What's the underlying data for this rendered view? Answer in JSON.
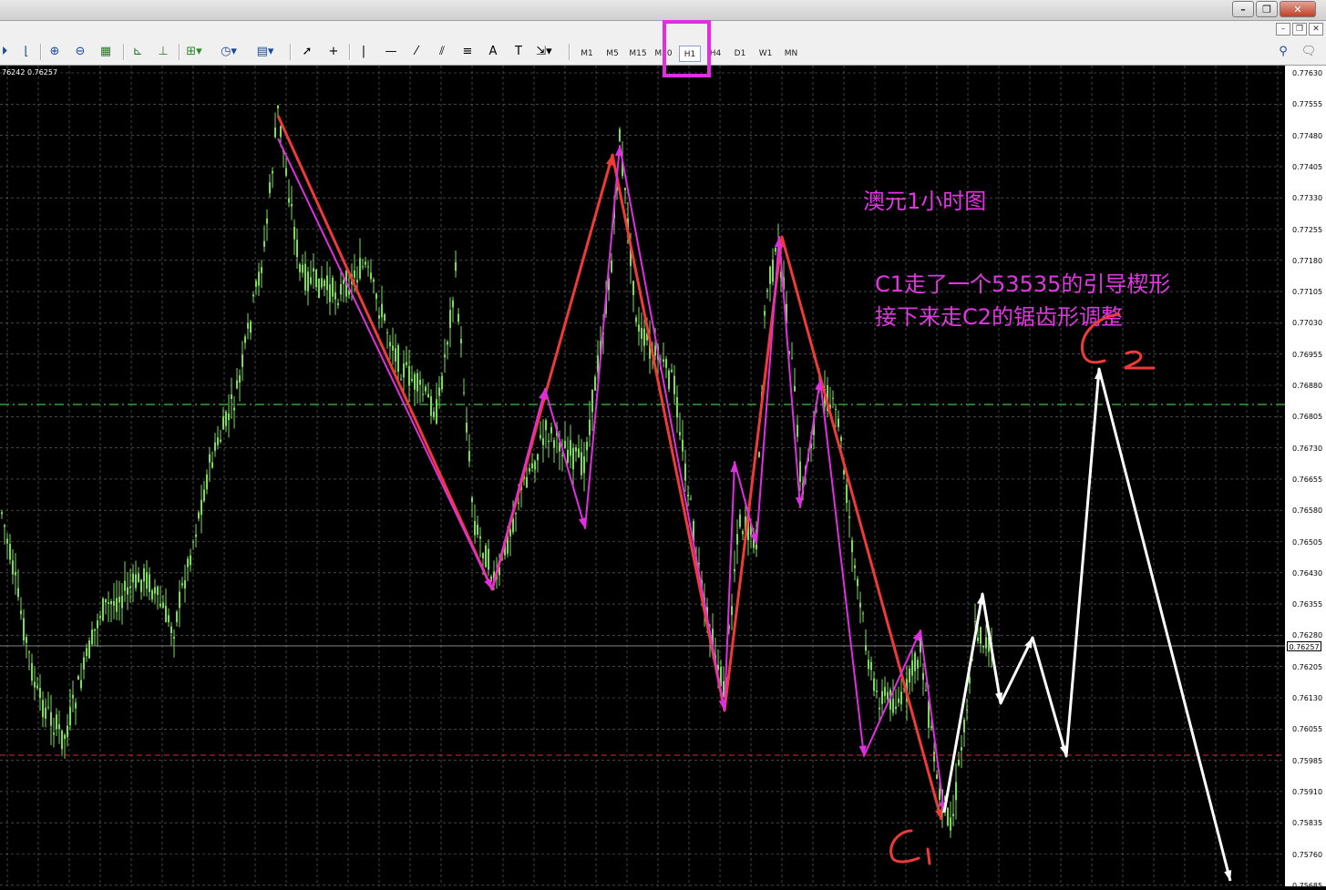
{
  "toolbar": {
    "timeframes": [
      "M1",
      "M5",
      "M15",
      "M30",
      "H1",
      "H4",
      "D1",
      "W1",
      "MN"
    ],
    "active": "H1",
    "icons": [
      "zoom-in-icon",
      "zoom-out-icon",
      "tile-icon",
      "autoscroll-icon",
      "chart-shift-icon",
      "new-order-icon",
      "clock-icon",
      "template-icon",
      "cursor-icon",
      "crosshair-icon",
      "vertical-line-icon",
      "horizontal-line-icon",
      "trendline-icon",
      "channel-icon",
      "fibo-icon",
      "text-icon",
      "label-icon",
      "arrow-icon"
    ]
  },
  "chart": {
    "quote_text": "76242 0.76257",
    "price_ticks": [
      "0.77630",
      "0.77555",
      "0.77480",
      "0.77405",
      "0.77330",
      "0.77255",
      "0.77180",
      "0.77105",
      "0.77030",
      "0.76955",
      "0.76880",
      "0.76805",
      "0.76730",
      "0.76655",
      "0.76580",
      "0.76505",
      "0.76430",
      "0.76355",
      "0.76280",
      "0.76205",
      "0.76130",
      "0.76055",
      "0.75985",
      "0.75910",
      "0.75835",
      "0.75760",
      "0.75685"
    ],
    "current_price": "0.76257",
    "colors": {
      "bg": "#000000",
      "candle": "#7bdc5a",
      "grid": "#6e6e6e",
      "magenta": "#e12ee2",
      "red": "#ef3a3a",
      "white": "#ffffff",
      "green_dashed": "#3fbf3f",
      "red_dashed": "#c83232"
    }
  },
  "annotations": {
    "title": "澳元1小时图",
    "line1": "C1走了一个53535的引导楔形",
    "line2": "接下来走C2的锯齿形调整",
    "c1": "C1",
    "c2": "C2"
  }
}
